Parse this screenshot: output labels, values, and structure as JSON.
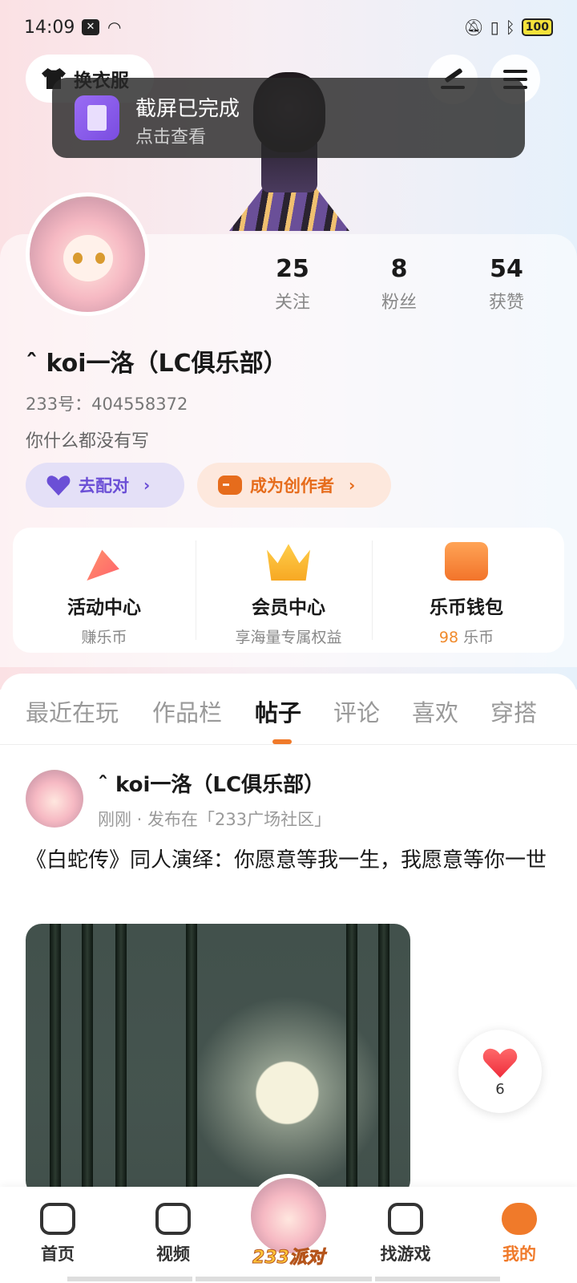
{
  "status_bar": {
    "time": "14:09",
    "battery": "100",
    "icons": [
      "notification-x-icon",
      "wifi-icon",
      "mute-icon",
      "vibrate-icon",
      "bluetooth-icon",
      "battery-icon"
    ]
  },
  "top": {
    "outfit_label": "换衣服"
  },
  "toast": {
    "title": "截屏已完成",
    "subtitle": "点击查看"
  },
  "profile": {
    "stats": [
      {
        "value": "25",
        "label": "关注"
      },
      {
        "value": "8",
        "label": "粉丝"
      },
      {
        "value": "54",
        "label": "获赞"
      }
    ],
    "username": "ˆ koi一洛（LC俱乐部）",
    "uid": "233号：404558372",
    "bio": "你什么都没有写",
    "match_label": "去配对",
    "creator_label": "成为创作者"
  },
  "quick_actions": [
    {
      "title": "活动中心",
      "sub": "赚乐币"
    },
    {
      "title": "会员中心",
      "sub": "享海量专属权益"
    },
    {
      "title": "乐币钱包",
      "sub_value": "98",
      "sub_unit": "乐币"
    }
  ],
  "tabs": [
    "最近在玩",
    "作品栏",
    "帖子",
    "评论",
    "喜欢",
    "穿搭"
  ],
  "active_tab": "帖子",
  "post": {
    "author": "ˆ koi一洛（LC俱乐部）",
    "meta": "刚刚 · 发布在「233广场社区」",
    "text": "《白蛇传》同人演绎：你愿意等我一生，我愿意等你一世",
    "likes": "6"
  },
  "bottom_nav": [
    {
      "label": "首页",
      "icon": "gamepad-icon"
    },
    {
      "label": "视频",
      "icon": "play-icon"
    },
    {
      "label": "233派对",
      "icon": "avatar-party-icon"
    },
    {
      "label": "找游戏",
      "icon": "list-icon"
    },
    {
      "label": "我的",
      "icon": "profile-face-icon"
    }
  ],
  "colors": {
    "accent": "#f07a2a",
    "match": "#6b4fd6",
    "creator": "#e66c1c",
    "like": "#ef2d3c"
  }
}
